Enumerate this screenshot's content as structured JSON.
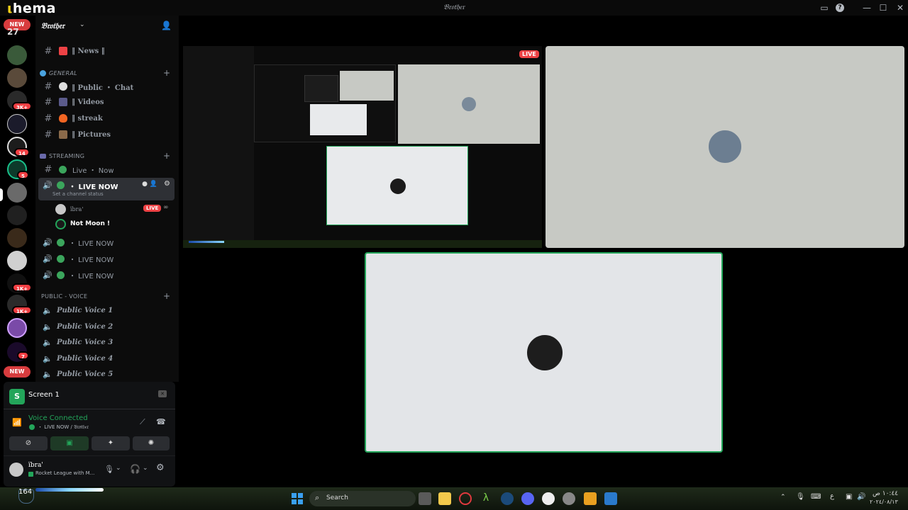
{
  "window": {
    "logo": "hema",
    "logo_prefix": "ι",
    "title": "𝔅𝔯𝔬𝔱𝔥𝔢𝔯"
  },
  "server": {
    "name": "𝔅𝔯𝔬𝔱𝔥𝔢𝔯"
  },
  "rail": {
    "new_top": "NEW",
    "new_bottom": "NEW",
    "counts": [
      "3K+",
      "14",
      "5",
      "1K+",
      "1K+",
      "7"
    ],
    "logo_text": "27"
  },
  "channels": {
    "news": "‖ News ‖",
    "cat_general": "GENERAL",
    "public_chat": "‖ Public ・ Chat",
    "videos": "‖ Videos",
    "streak": "‖ streak",
    "pictures": "‖ Pictures",
    "cat_streaming": "STREAMING",
    "live_now_text": "Live ・ Now",
    "live_voice_active": "・ LIVE NOW",
    "channel_status": "Set a channel status",
    "user_ibra": "ïbra'",
    "live_badge": "LIVE",
    "user_notmoon": "Not Moon !",
    "live_voice_2": "・ LIVE NOW",
    "live_voice_3": "・ LIVE NOW",
    "live_voice_4": "・ LIVE NOW",
    "cat_public_voice": "PUBLIC - VOICE",
    "pv1": "Public Voice 1",
    "pv2": "Public Voice 2",
    "pv3": "Public Voice 3",
    "pv4": "Public Voice 4",
    "pv5": "Public Voice 5"
  },
  "panel": {
    "screen_label": "Screen 1",
    "voice_status": "Voice Connected",
    "voice_location": "・ LIVE NOW / 𝔅𝔯𝔬𝔱𝔥𝔢𝔯",
    "username": "ïbra'",
    "activity": "Rocket League with M..."
  },
  "stage": {
    "live_badge": "LIVE"
  },
  "taskbar": {
    "search_label": "Search",
    "game_counter": "164",
    "clock_time": "١٠:٤٤ ص",
    "clock_date": "٢٠٢٤/٠٨/١٣",
    "lang": "ع"
  },
  "colors": {
    "accent_green": "#23a55a",
    "live_red": "#ed4245",
    "tile_bg": "#e3e5e8"
  }
}
